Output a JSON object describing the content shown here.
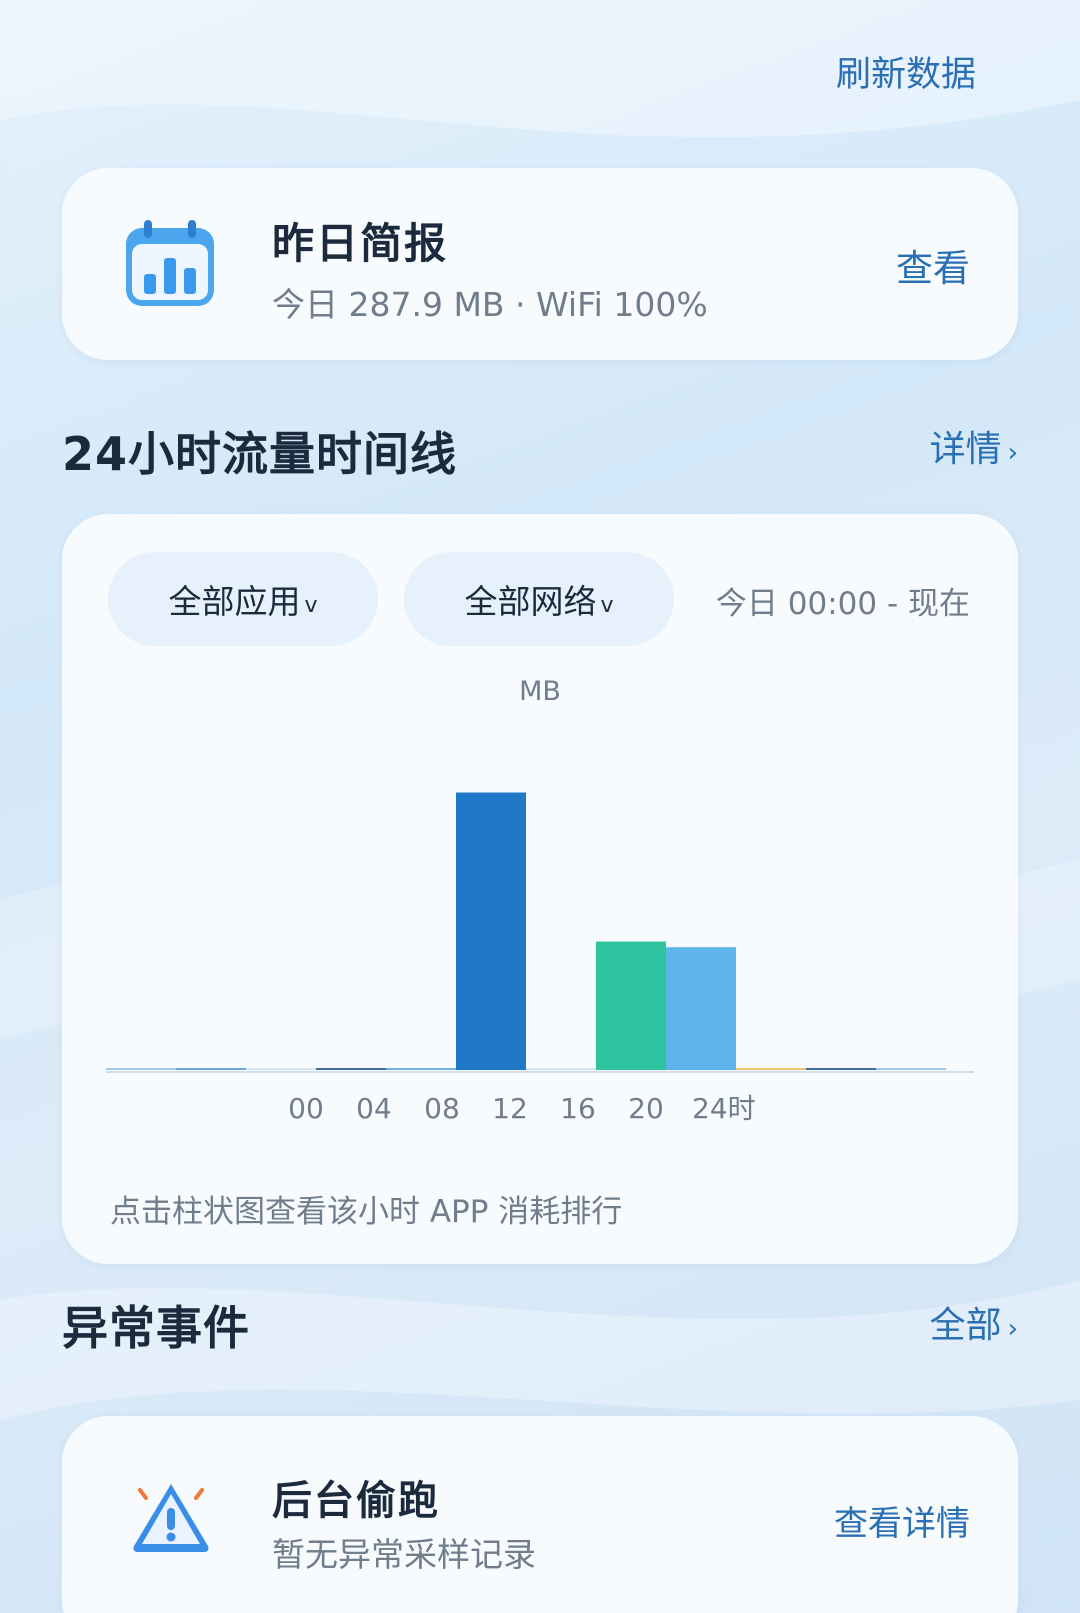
{
  "header": {
    "refresh_label": "刷新数据"
  },
  "brief": {
    "title": "昨日简报",
    "subtitle": "今日 287.9 MB · WiFi 100%",
    "view_label": "查看",
    "icon": "calendar-chart-icon"
  },
  "timeline": {
    "title": "24小时流量时间线",
    "detail_label": "详情",
    "filter_app": "全部应用",
    "filter_network": "全部网络",
    "range_text": "今日 00:00 - 现在",
    "hint": "点击柱状图查看该小时 APP 消耗排行"
  },
  "chart_data": {
    "type": "bar",
    "ylabel": "MB",
    "x_ticks": [
      "00",
      "04",
      "08",
      "12",
      "16",
      "20",
      "24时"
    ],
    "bins": [
      "00-02",
      "02-04",
      "04-06",
      "06-08",
      "08-10",
      "10-12",
      "12-14",
      "14-16",
      "16-18",
      "18-20",
      "20-22",
      "22-24"
    ],
    "values": [
      0.3,
      0.3,
      0.0,
      0.3,
      0.8,
      148.0,
      0.0,
      68.5,
      65.5,
      0.3,
      0.3,
      0.2
    ],
    "colors": [
      "#9fcbe9",
      "#6aa9d6",
      "#d7e6f2",
      "#3f6f9a",
      "#6fb3e3",
      "#1f78c8",
      "#d7e6f2",
      "#2ec4a0",
      "#5db4ec",
      "#f0c36b",
      "#3f6f9a",
      "#9fcbe9"
    ],
    "ylim": [
      0,
      160
    ]
  },
  "anomalies": {
    "title": "异常事件",
    "all_label": "全部",
    "item": {
      "title": "后台偷跑",
      "subtitle": "暂无异常采样记录",
      "view_label": "查看详情",
      "icon": "warning-icon"
    }
  },
  "colors": {
    "accent": "#2a6fb3",
    "card": "#f7fbfe",
    "muted": "#6f7d8c"
  }
}
